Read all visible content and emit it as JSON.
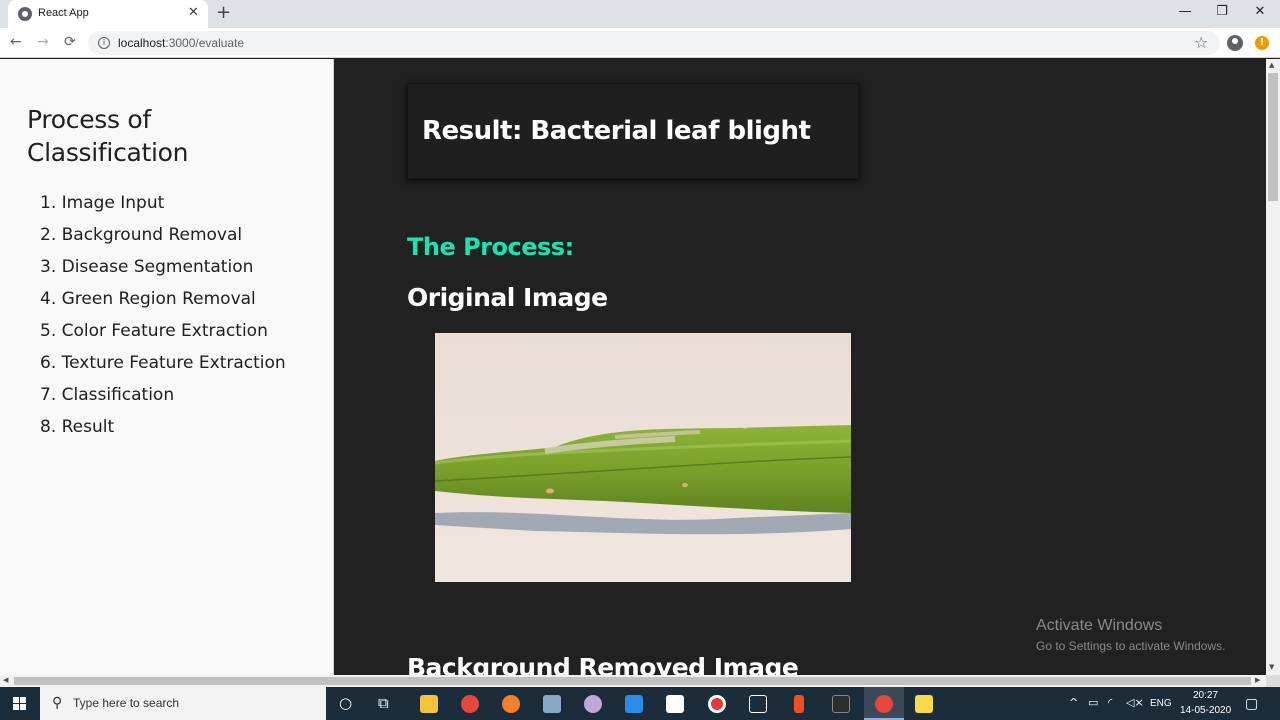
{
  "browser": {
    "tab_title": "React App",
    "tab_close": "✕",
    "new_tab": "+",
    "url_host": "localhost",
    "url_path": ":3000/evaluate",
    "window_controls": {
      "minimize": "—",
      "maximize": "❐",
      "close": "✕"
    }
  },
  "sidebar": {
    "title": "Process of Classification",
    "steps": [
      "1. Image Input",
      "2. Background Removal",
      "3. Disease Segmentation",
      "4. Green Region Removal",
      "5. Color Feature Extraction",
      "6. Texture Feature Extraction",
      "7. Classification",
      "8. Result"
    ]
  },
  "main": {
    "result_label": "Result: Bacterial leaf blight",
    "process_heading": "The Process:",
    "original_image_heading": "Original Image",
    "background_removed_heading": "Background Removed Image"
  },
  "watermark": {
    "line1": "Activate Windows",
    "line2": "Go to Settings to activate Windows."
  },
  "taskbar": {
    "search_placeholder": "Type here to search",
    "language": "ENG",
    "time": "20:27",
    "date": "14-05-2020"
  },
  "colors": {
    "accent_teal": "#19e3b1",
    "main_bg": "#212121",
    "sidebar_bg": "#f9f9f9"
  }
}
